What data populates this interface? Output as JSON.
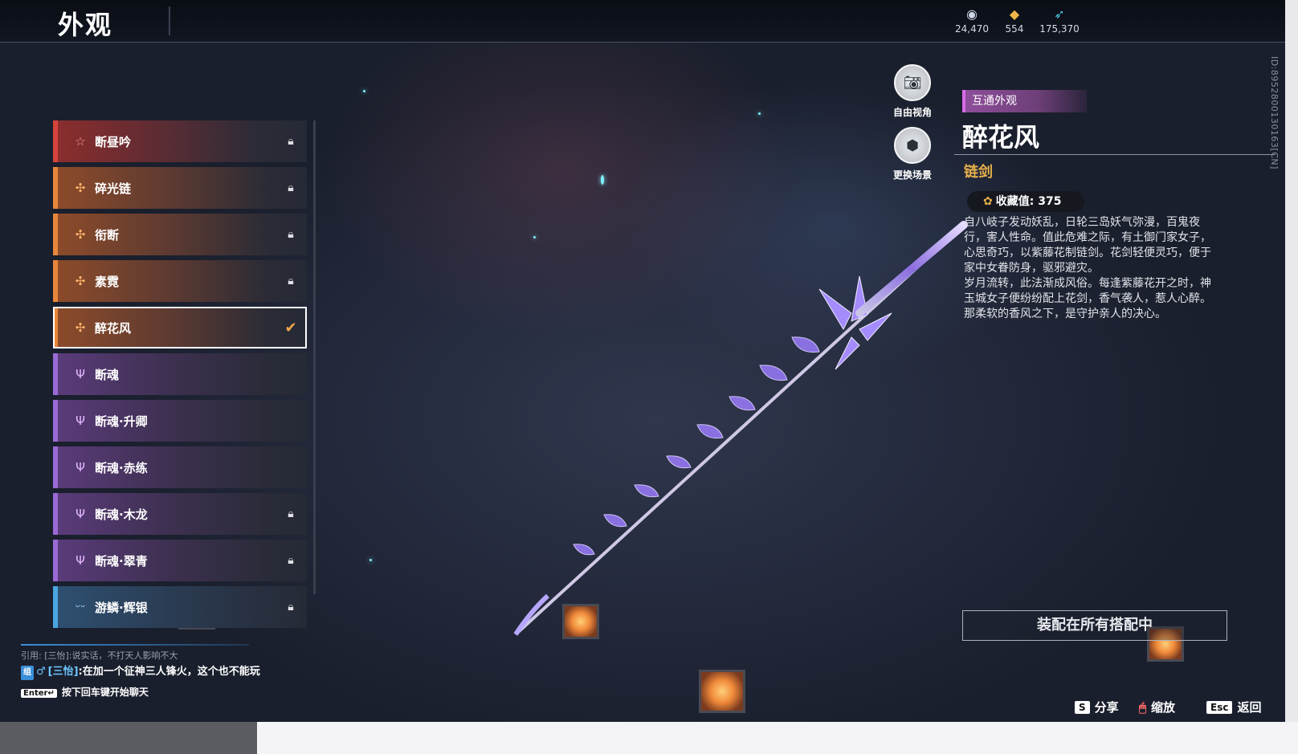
{
  "header": {
    "title": "外观"
  },
  "currencies": [
    {
      "icon": "jade-coin-icon",
      "value": "24,470"
    },
    {
      "icon": "gold-ingot-icon",
      "value": "554"
    },
    {
      "icon": "feather-icon",
      "value": "175,370"
    }
  ],
  "list": {
    "items": [
      {
        "label": "断昼吟",
        "rank": "red",
        "icon": "star-icon",
        "status": "locked"
      },
      {
        "label": "碎光链",
        "rank": "gold",
        "icon": "cross-icon",
        "status": "locked"
      },
      {
        "label": "衔断",
        "rank": "gold",
        "icon": "cross-icon",
        "status": "locked"
      },
      {
        "label": "素霓",
        "rank": "gold",
        "icon": "cross-icon",
        "status": "locked"
      },
      {
        "label": "醉花风",
        "rank": "gold",
        "icon": "cross-icon",
        "status": "equipped",
        "selected": true
      },
      {
        "label": "断魂",
        "rank": "purple",
        "icon": "trident-icon",
        "status": ""
      },
      {
        "label": "断魂·升卿",
        "rank": "purple",
        "icon": "trident-icon",
        "status": ""
      },
      {
        "label": "断魂·赤练",
        "rank": "purple",
        "icon": "trident-icon",
        "status": ""
      },
      {
        "label": "断魂·木龙",
        "rank": "purple",
        "icon": "trident-icon",
        "status": "locked"
      },
      {
        "label": "断魂·翠青",
        "rank": "purple",
        "icon": "trident-icon",
        "status": "locked"
      },
      {
        "label": "游鳞·辉银",
        "rank": "blue",
        "icon": "fin-icon",
        "status": "locked"
      }
    ]
  },
  "camera": {
    "free_view_label": "自由视角",
    "change_scene_label": "更换场景"
  },
  "detail": {
    "tag": "互通外观",
    "name": "醉花风",
    "type": "链剑",
    "collect_label": "收藏值: 375",
    "description": [
      "自八岐子发动妖乱，日轮三岛妖气弥漫，百鬼夜",
      "行，害人性命。值此危难之际，有土御门家女子，",
      "心思奇巧，以紫藤花制链剑。花剑轻便灵巧，便于",
      "家中女眷防身，驱邪避灾。",
      "岁月流转，此法渐成风俗。每逢紫藤花开之时，神",
      "玉城女子便纷纷配上花剑，香气袭人，惹人心醉。",
      "那柔软的香风之下，是守护亲人的决心。"
    ],
    "equip_label": "装配在所有搭配中",
    "id_text": "ID:8952800130163[CN]"
  },
  "chat": {
    "quote": "引用: [三怡]:说实话，不打天人影响不大",
    "channel_badge": "组",
    "nick": "[三怡]",
    "message": ":在加一个征神三人锋火，这个也不能玩",
    "enter_key": "Enter↵",
    "hint": "按下回车键开始聊天"
  },
  "hotkeys": {
    "share_key": "S",
    "share_label": "分享",
    "zoom_label": "缩放",
    "back_key": "Esc",
    "back_label": "返回"
  },
  "colors": {
    "accent_gold": "#e8b04a",
    "rank_red": "#d6443c",
    "rank_gold": "#e8873a",
    "rank_purple": "#9a6ad6",
    "rank_blue": "#4aa6e0",
    "tag_purple": "#8e4e9b"
  }
}
